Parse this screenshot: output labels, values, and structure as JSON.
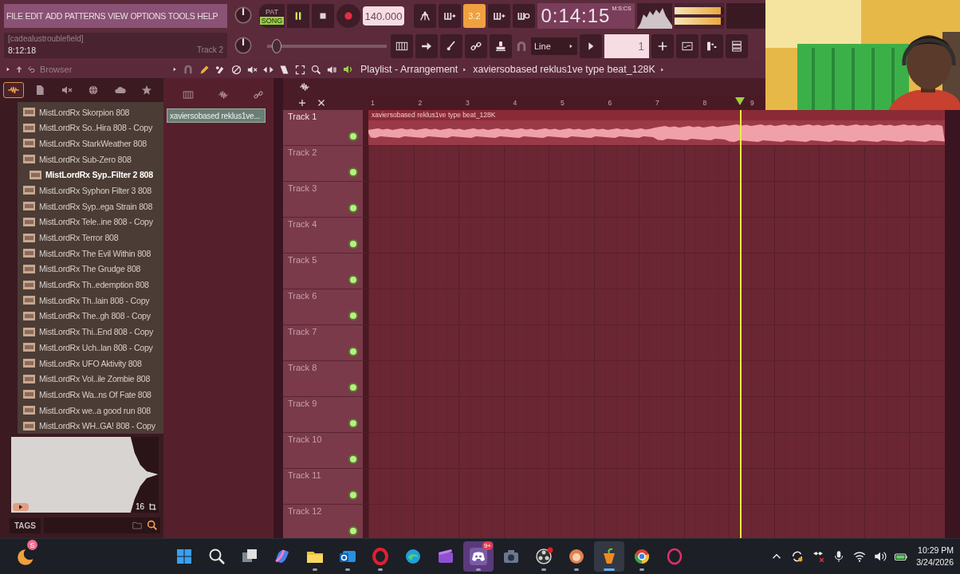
{
  "menu": [
    "FILE",
    "EDIT",
    "ADD",
    "PATTERNS",
    "VIEW",
    "OPTIONS",
    "TOOLS",
    "HELP"
  ],
  "hint_bar": {
    "text": "[cadealustroublefield]",
    "time": "8:12:18",
    "target": "Track 2"
  },
  "transport": {
    "pat_label": "PAT",
    "song_label": "SONG",
    "song_mode": true,
    "playing": true,
    "recording": false,
    "tempo": "140.000"
  },
  "step_display": "3.2",
  "song_time": {
    "value": "0:14:15",
    "unit": "M:S:CS"
  },
  "output_meters": [
    {
      "level": 0.93
    },
    {
      "level": 0.93
    }
  ],
  "master_pitch": {
    "level": 0.04
  },
  "snap": "Line",
  "pattern_selector": "1",
  "browser": {
    "title": "Browser",
    "tabs": [
      {
        "kind": "all",
        "selected": true
      },
      {
        "kind": "files",
        "selected": false
      },
      {
        "kind": "speaker",
        "selected": false
      },
      {
        "kind": "globe",
        "selected": false
      },
      {
        "kind": "cloud",
        "selected": false
      },
      {
        "kind": "star",
        "selected": false
      }
    ],
    "items": [
      {
        "name": "MistLordRx Skorpion 808",
        "selected": false
      },
      {
        "name": "MistLordRx So..Hira 808 - Copy",
        "selected": false
      },
      {
        "name": "MistLordRx StarkWeather 808",
        "selected": false
      },
      {
        "name": "MistLordRx Sub-Zero 808",
        "selected": false
      },
      {
        "name": "MistLordRx Syp..Filter 2 808",
        "selected": true
      },
      {
        "name": "MistLordRx Syphon Filter 3 808",
        "selected": false
      },
      {
        "name": "MistLordRx Syp..ega Strain 808",
        "selected": false
      },
      {
        "name": "MistLordRx Tele..ine 808 - Copy",
        "selected": false
      },
      {
        "name": "MistLordRx Terror 808",
        "selected": false
      },
      {
        "name": "MistLordRx The Evil Within 808",
        "selected": false
      },
      {
        "name": "MistLordRx The Grudge 808",
        "selected": false
      },
      {
        "name": "MistLordRx Th..edemption 808",
        "selected": false
      },
      {
        "name": "MistLordRx Th..lain 808 - Copy",
        "selected": false
      },
      {
        "name": "MistLordRx The..gh 808 - Copy",
        "selected": false
      },
      {
        "name": "MistLordRx Thi..End 808 - Copy",
        "selected": false
      },
      {
        "name": "MistLordRx Uch..lan 808 - Copy",
        "selected": false
      },
      {
        "name": "MistLordRx UFO Aktivity 808",
        "selected": false
      },
      {
        "name": "MistLordRx Vol..ile Zombie 808",
        "selected": false
      },
      {
        "name": "MistLordRx Wa..ns Of Fate 808",
        "selected": false
      },
      {
        "name": "MistLordRx we..a good run 808",
        "selected": false
      },
      {
        "name": "MistLordRx WH..GA! 808 - Copy",
        "selected": false
      }
    ],
    "preview_count": "16",
    "tags_label": "TAGS"
  },
  "playlist": {
    "title": "Playlist - Arrangement",
    "pattern": "xaviersobased reklus1ve type beat_128K",
    "clip_list": [
      {
        "name": "xaviersobased reklus1ve...",
        "selected": true
      }
    ],
    "ruler": [
      "1",
      "2",
      "3",
      "4",
      "5",
      "6",
      "7",
      "8",
      "9"
    ],
    "playhead": {
      "level": 0.645
    },
    "tracks": [
      {
        "name": "Track 1",
        "enabled": true,
        "clip": "xaviersobased reklus1ve type beat_128K"
      },
      {
        "name": "Track 2",
        "enabled": true
      },
      {
        "name": "Track 3",
        "enabled": true
      },
      {
        "name": "Track 4",
        "enabled": true
      },
      {
        "name": "Track 5",
        "enabled": true
      },
      {
        "name": "Track 6",
        "enabled": true
      },
      {
        "name": "Track 7",
        "enabled": true
      },
      {
        "name": "Track 8",
        "enabled": true
      },
      {
        "name": "Track 9",
        "enabled": true
      },
      {
        "name": "Track 10",
        "enabled": true
      },
      {
        "name": "Track 11",
        "enabled": true
      },
      {
        "name": "Track 12",
        "enabled": true
      }
    ]
  },
  "taskbar": {
    "widget_badge": "S",
    "apps": [
      {
        "kind": "start",
        "running": false,
        "selected": false
      },
      {
        "kind": "search",
        "running": false,
        "selected": false
      },
      {
        "kind": "taskview",
        "running": false,
        "selected": false
      },
      {
        "kind": "copilot",
        "running": false,
        "selected": false
      },
      {
        "kind": "explorer",
        "running": true,
        "selected": false
      },
      {
        "kind": "outlook",
        "running": true,
        "selected": false
      },
      {
        "kind": "opera",
        "running": true,
        "selected": false
      },
      {
        "kind": "edge",
        "running": false,
        "selected": false
      },
      {
        "kind": "clipchamp",
        "running": false,
        "selected": false
      },
      {
        "kind": "discord",
        "running": true,
        "selected": false,
        "badge": "9+"
      },
      {
        "kind": "camera",
        "running": false,
        "selected": false
      },
      {
        "kind": "obs",
        "running": true,
        "selected": false
      },
      {
        "kind": "mascot",
        "running": true,
        "selected": false
      },
      {
        "kind": "fl",
        "running": true,
        "selected": true
      },
      {
        "kind": "chrome",
        "running": true,
        "selected": false
      },
      {
        "kind": "operagx",
        "running": false,
        "selected": false
      }
    ],
    "clock": {
      "time": "10:29 PM",
      "date": "3/24/2026"
    }
  }
}
